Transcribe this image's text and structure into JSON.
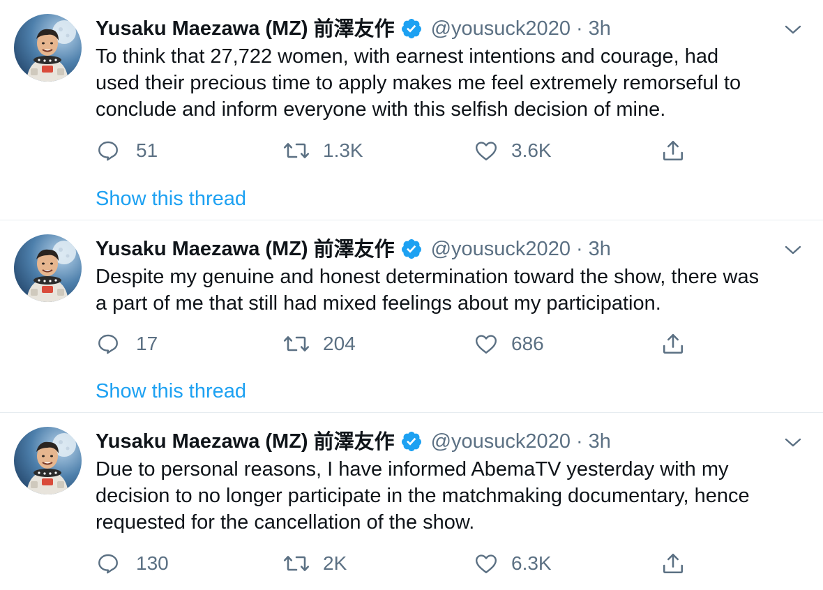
{
  "tweets": [
    {
      "author_name": "Yusaku Maezawa (MZ)",
      "author_name_cjk": "前澤友作",
      "handle": "@yousuck2020",
      "separator": "·",
      "time": "3h",
      "text": "To think that 27,722 women, with earnest intentions and courage, had\nused their precious time to apply makes me feel extremely remorseful to\nconclude and inform everyone with this selfish decision of mine.",
      "replies": "51",
      "retweets": "1.3K",
      "likes": "3.6K",
      "show_thread": "Show this thread"
    },
    {
      "author_name": "Yusaku Maezawa (MZ)",
      "author_name_cjk": "前澤友作",
      "handle": "@yousuck2020",
      "separator": "·",
      "time": "3h",
      "text": "Despite my genuine and honest determination toward the show, there was\na part of me that still had mixed feelings about my participation.",
      "replies": "17",
      "retweets": "204",
      "likes": "686",
      "show_thread": "Show this thread"
    },
    {
      "author_name": "Yusaku Maezawa (MZ)",
      "author_name_cjk": "前澤友作",
      "handle": "@yousuck2020",
      "separator": "·",
      "time": "3h",
      "text": "Due to personal reasons, I have informed AbemaTV yesterday with my\ndecision to no longer participate in the matchmaking documentary, hence\nrequested for the cancellation of the show.",
      "replies": "130",
      "retweets": "2K",
      "likes": "6.3K"
    }
  ],
  "icons": {
    "verified": "verified-badge-icon",
    "caret": "chevron-down-icon",
    "reply": "reply-bubble-icon",
    "retweet": "retweet-icon",
    "like": "heart-icon",
    "share": "share-upload-icon"
  },
  "colors": {
    "link": "#1da1f2",
    "muted": "#5b7083",
    "text": "#0f1419",
    "divider": "#e6ecf0",
    "verified": "#1da1f2"
  }
}
